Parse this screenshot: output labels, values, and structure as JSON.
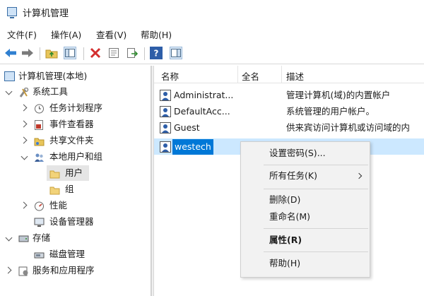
{
  "window": {
    "title": "计算机管理"
  },
  "menu": [
    "文件(F)",
    "操作(A)",
    "查看(V)",
    "帮助(H)"
  ],
  "tree": {
    "root": "计算机管理(本地)",
    "system_tools": "系统工具",
    "task_scheduler": "任务计划程序",
    "event_viewer": "事件查看器",
    "shared_folders": "共享文件夹",
    "local_users_groups": "本地用户和组",
    "users": "用户",
    "groups": "组",
    "performance": "性能",
    "device_manager": "设备管理器",
    "storage": "存储",
    "disk_management": "磁盘管理",
    "services_apps": "服务和应用程序"
  },
  "list": {
    "columns": {
      "name": "名称",
      "full_name": "全名",
      "description": "描述"
    },
    "rows": [
      {
        "name": "Administrat...",
        "full_name": "",
        "description": "管理计算机(域)的内置帐户"
      },
      {
        "name": "DefaultAcc...",
        "full_name": "",
        "description": "系统管理的用户帐户。"
      },
      {
        "name": "Guest",
        "full_name": "",
        "description": "供来宾访问计算机或访问域的内"
      },
      {
        "name": "westech",
        "full_name": "",
        "description": ""
      }
    ]
  },
  "context_menu": {
    "set_password": "设置密码(S)...",
    "all_tasks": "所有任务(K)",
    "delete": "删除(D)",
    "rename": "重命名(M)",
    "properties": "属性(R)",
    "help": "帮助(H)"
  },
  "colors": {
    "selection": "#cce8ff",
    "accent": "#0078d7",
    "delete_red": "#d32f2f"
  }
}
